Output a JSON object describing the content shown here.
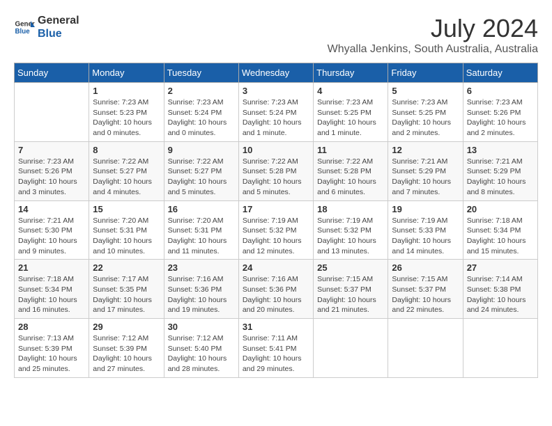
{
  "header": {
    "logo_general": "General",
    "logo_blue": "Blue",
    "month": "July 2024",
    "location": "Whyalla Jenkins, South Australia, Australia"
  },
  "days_of_week": [
    "Sunday",
    "Monday",
    "Tuesday",
    "Wednesday",
    "Thursday",
    "Friday",
    "Saturday"
  ],
  "weeks": [
    [
      {
        "day": "",
        "info": ""
      },
      {
        "day": "1",
        "info": "Sunrise: 7:23 AM\nSunset: 5:23 PM\nDaylight: 10 hours\nand 0 minutes."
      },
      {
        "day": "2",
        "info": "Sunrise: 7:23 AM\nSunset: 5:24 PM\nDaylight: 10 hours\nand 0 minutes."
      },
      {
        "day": "3",
        "info": "Sunrise: 7:23 AM\nSunset: 5:24 PM\nDaylight: 10 hours\nand 1 minute."
      },
      {
        "day": "4",
        "info": "Sunrise: 7:23 AM\nSunset: 5:25 PM\nDaylight: 10 hours\nand 1 minute."
      },
      {
        "day": "5",
        "info": "Sunrise: 7:23 AM\nSunset: 5:25 PM\nDaylight: 10 hours\nand 2 minutes."
      },
      {
        "day": "6",
        "info": "Sunrise: 7:23 AM\nSunset: 5:26 PM\nDaylight: 10 hours\nand 2 minutes."
      }
    ],
    [
      {
        "day": "7",
        "info": "Sunrise: 7:23 AM\nSunset: 5:26 PM\nDaylight: 10 hours\nand 3 minutes."
      },
      {
        "day": "8",
        "info": "Sunrise: 7:22 AM\nSunset: 5:27 PM\nDaylight: 10 hours\nand 4 minutes."
      },
      {
        "day": "9",
        "info": "Sunrise: 7:22 AM\nSunset: 5:27 PM\nDaylight: 10 hours\nand 5 minutes."
      },
      {
        "day": "10",
        "info": "Sunrise: 7:22 AM\nSunset: 5:28 PM\nDaylight: 10 hours\nand 5 minutes."
      },
      {
        "day": "11",
        "info": "Sunrise: 7:22 AM\nSunset: 5:28 PM\nDaylight: 10 hours\nand 6 minutes."
      },
      {
        "day": "12",
        "info": "Sunrise: 7:21 AM\nSunset: 5:29 PM\nDaylight: 10 hours\nand 7 minutes."
      },
      {
        "day": "13",
        "info": "Sunrise: 7:21 AM\nSunset: 5:29 PM\nDaylight: 10 hours\nand 8 minutes."
      }
    ],
    [
      {
        "day": "14",
        "info": "Sunrise: 7:21 AM\nSunset: 5:30 PM\nDaylight: 10 hours\nand 9 minutes."
      },
      {
        "day": "15",
        "info": "Sunrise: 7:20 AM\nSunset: 5:31 PM\nDaylight: 10 hours\nand 10 minutes."
      },
      {
        "day": "16",
        "info": "Sunrise: 7:20 AM\nSunset: 5:31 PM\nDaylight: 10 hours\nand 11 minutes."
      },
      {
        "day": "17",
        "info": "Sunrise: 7:19 AM\nSunset: 5:32 PM\nDaylight: 10 hours\nand 12 minutes."
      },
      {
        "day": "18",
        "info": "Sunrise: 7:19 AM\nSunset: 5:32 PM\nDaylight: 10 hours\nand 13 minutes."
      },
      {
        "day": "19",
        "info": "Sunrise: 7:19 AM\nSunset: 5:33 PM\nDaylight: 10 hours\nand 14 minutes."
      },
      {
        "day": "20",
        "info": "Sunrise: 7:18 AM\nSunset: 5:34 PM\nDaylight: 10 hours\nand 15 minutes."
      }
    ],
    [
      {
        "day": "21",
        "info": "Sunrise: 7:18 AM\nSunset: 5:34 PM\nDaylight: 10 hours\nand 16 minutes."
      },
      {
        "day": "22",
        "info": "Sunrise: 7:17 AM\nSunset: 5:35 PM\nDaylight: 10 hours\nand 17 minutes."
      },
      {
        "day": "23",
        "info": "Sunrise: 7:16 AM\nSunset: 5:36 PM\nDaylight: 10 hours\nand 19 minutes."
      },
      {
        "day": "24",
        "info": "Sunrise: 7:16 AM\nSunset: 5:36 PM\nDaylight: 10 hours\nand 20 minutes."
      },
      {
        "day": "25",
        "info": "Sunrise: 7:15 AM\nSunset: 5:37 PM\nDaylight: 10 hours\nand 21 minutes."
      },
      {
        "day": "26",
        "info": "Sunrise: 7:15 AM\nSunset: 5:37 PM\nDaylight: 10 hours\nand 22 minutes."
      },
      {
        "day": "27",
        "info": "Sunrise: 7:14 AM\nSunset: 5:38 PM\nDaylight: 10 hours\nand 24 minutes."
      }
    ],
    [
      {
        "day": "28",
        "info": "Sunrise: 7:13 AM\nSunset: 5:39 PM\nDaylight: 10 hours\nand 25 minutes."
      },
      {
        "day": "29",
        "info": "Sunrise: 7:12 AM\nSunset: 5:39 PM\nDaylight: 10 hours\nand 27 minutes."
      },
      {
        "day": "30",
        "info": "Sunrise: 7:12 AM\nSunset: 5:40 PM\nDaylight: 10 hours\nand 28 minutes."
      },
      {
        "day": "31",
        "info": "Sunrise: 7:11 AM\nSunset: 5:41 PM\nDaylight: 10 hours\nand 29 minutes."
      },
      {
        "day": "",
        "info": ""
      },
      {
        "day": "",
        "info": ""
      },
      {
        "day": "",
        "info": ""
      }
    ]
  ]
}
